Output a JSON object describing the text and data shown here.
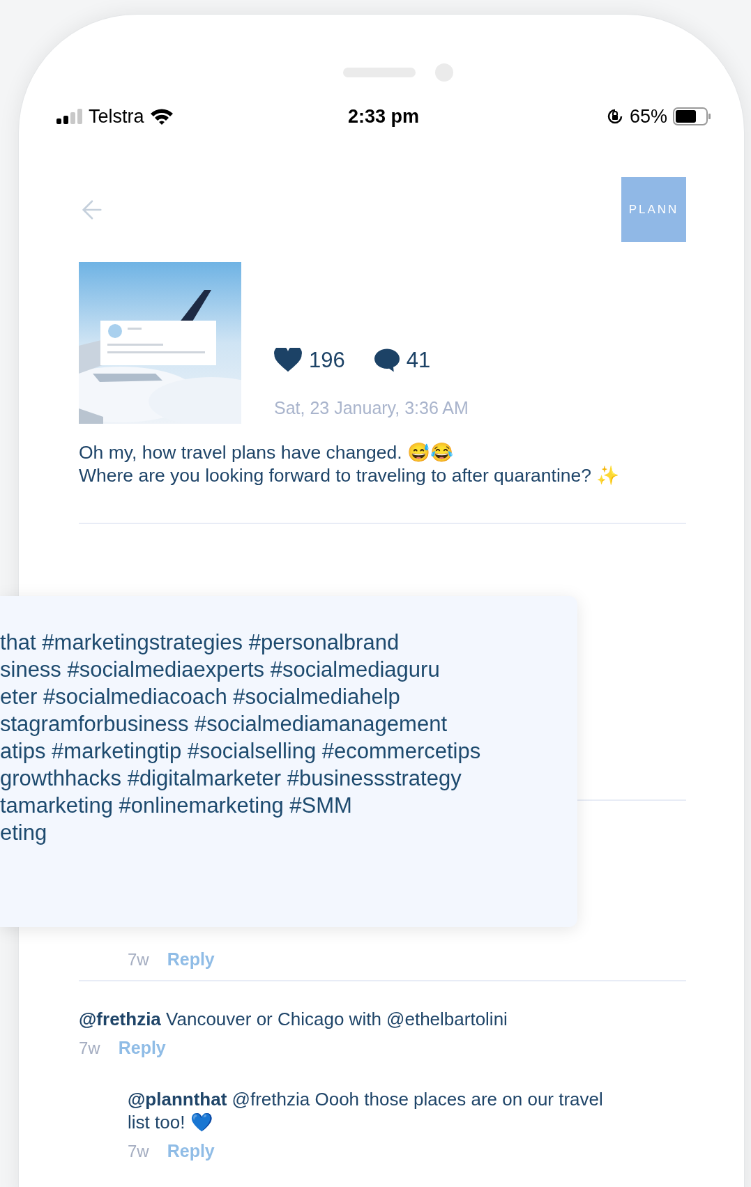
{
  "status_bar": {
    "carrier": "Telstra",
    "time": "2:33 pm",
    "battery": "65%"
  },
  "header": {
    "logo": "PLANN"
  },
  "post": {
    "likes": "196",
    "comments": "41",
    "date": "Sat, 23 January, 3:36 AM",
    "caption": [
      "Oh my, how travel plans have changed. 😅😂",
      "Where are you looking forward to traveling to after quarantine? ✨"
    ]
  },
  "hashtag_popup": {
    "lines": [
      "that #marketingstrategies #personalbrand",
      "siness #socialmediaexperts #socialmediaguru",
      "eter #socialmediacoach #socialmediahelp",
      "stagramforbusiness #socialmediamanagement",
      "atips #marketingtip #socialselling #ecommercetips",
      "growthhacks #digitalmarketer #businessstrategy",
      "tamarketing #onlinemarketing #SMM",
      "eting"
    ]
  },
  "earlier_replies": [
    {
      "age": "7w",
      "action": "Reply"
    }
  ],
  "comments": [
    {
      "author": "@frethzia",
      "text": "Vancouver or Chicago with @ethelbartolini",
      "age": "7w",
      "action": "Reply",
      "children": [
        {
          "author": "@plannthat",
          "text": "@frethzia Oooh those places are on our travel list too! 💙",
          "age": "7w",
          "action": "Reply"
        }
      ]
    }
  ]
}
